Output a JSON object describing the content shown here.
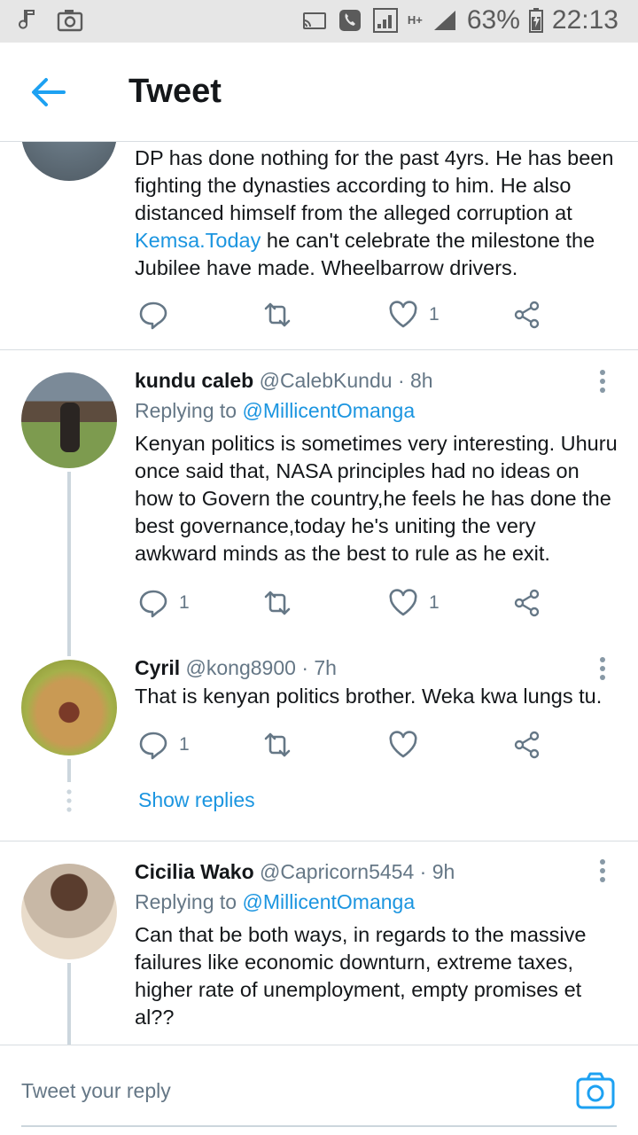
{
  "status_bar": {
    "battery": "63%",
    "time": "22:13",
    "network": "H+"
  },
  "app_bar": {
    "title": "Tweet",
    "back_icon": "arrow-left-icon"
  },
  "tweets": [
    {
      "text_before": "DP has done nothing for the past 4yrs. He has been fighting the dynasties according to him. He also distanced himself from the alleged corruption at ",
      "link": "Kemsa.Today",
      "text_after": " he can't celebrate the milestone the Jubilee have made. Wheelbarrow drivers.",
      "reply_count": "",
      "like_count": "1"
    },
    {
      "name": "kundu caleb",
      "handle": "@CalebKundu",
      "time": "· 8h",
      "replying_label": "Replying to",
      "replying_to": "@MillicentOmanga",
      "text": "Kenyan politics is sometimes very interesting. Uhuru once said that, NASA principles had no ideas on how to Govern the country,he feels he has done the best governance,today he's uniting the very awkward minds as the best to rule as he exit.",
      "reply_count": "1",
      "like_count": "1"
    },
    {
      "name": "Cyril",
      "handle": "@kong8900",
      "time": "· 7h",
      "text": "That is kenyan politics brother. Weka kwa lungs tu.",
      "reply_count": "1",
      "like_count": ""
    },
    {
      "name": "Cicilia Wako",
      "handle": "@Capricorn5454",
      "time": "· 9h",
      "replying_label": "Replying to",
      "replying_to": "@MillicentOmanga",
      "text": "Can that be both ways, in regards to the massive failures like economic downturn, extreme taxes, higher rate of unemployment, empty promises et al??"
    }
  ],
  "show_replies": "Show replies",
  "reply_bar": {
    "placeholder": "Tweet your reply",
    "camera_icon": "camera-icon"
  },
  "colors": {
    "accent": "#1b95e0",
    "muted": "#657786",
    "text": "#14171a",
    "divider": "#d8dde1"
  }
}
